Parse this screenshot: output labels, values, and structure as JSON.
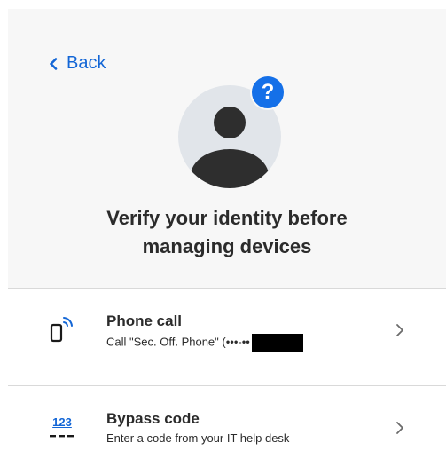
{
  "back": {
    "label": "Back"
  },
  "avatar": {
    "badge_symbol": "?",
    "badge_color": "#1570e8",
    "icon": "user-silhouette-icon"
  },
  "title": "Verify your identity before\nmanaging devices",
  "methods": [
    {
      "icon": "phone-call-icon",
      "title": "Phone call",
      "subtitle": "Call \"Sec. Off. Phone\" (•••-••"
    },
    {
      "icon": "bypass-code-icon",
      "icon_text": "123",
      "title": "Bypass code",
      "subtitle": "Enter a code from your IT help desk"
    }
  ],
  "colors": {
    "accent": "#1366d6",
    "panel_background": "#f7f7f7",
    "divider": "#d9d9d9",
    "avatar_background": "#e1e5ea",
    "avatar_figure": "#2e2e2e"
  }
}
